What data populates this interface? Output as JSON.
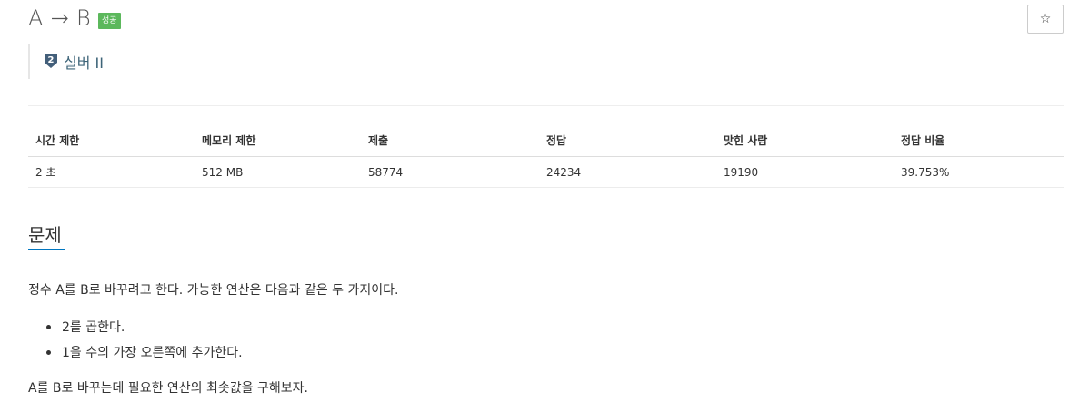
{
  "problem": {
    "title": "A → B",
    "result_badge": "성공",
    "tier_number": "2",
    "tier_label": "실버 II",
    "star_icon": "☆"
  },
  "info_table": {
    "headers": [
      "시간 제한",
      "메모리 제한",
      "제출",
      "정답",
      "맞힌 사람",
      "정답 비율"
    ],
    "values": [
      "2 초",
      "512 MB",
      "58774",
      "24234",
      "19190",
      "39.753%"
    ]
  },
  "section": {
    "title": "문제",
    "paragraph1": "정수 A를 B로 바꾸려고 한다. 가능한 연산은 다음과 같은 두 가지이다.",
    "operations": [
      "2를 곱한다.",
      "1을 수의 가장 오른쪽에 추가한다."
    ],
    "paragraph2": "A를 B로 바꾸는데 필요한 연산의 최솟값을 구해보자."
  },
  "colors": {
    "badge_success": "#5cb85c",
    "tier_silver": "#435f7a",
    "section_accent": "#0076c0"
  }
}
